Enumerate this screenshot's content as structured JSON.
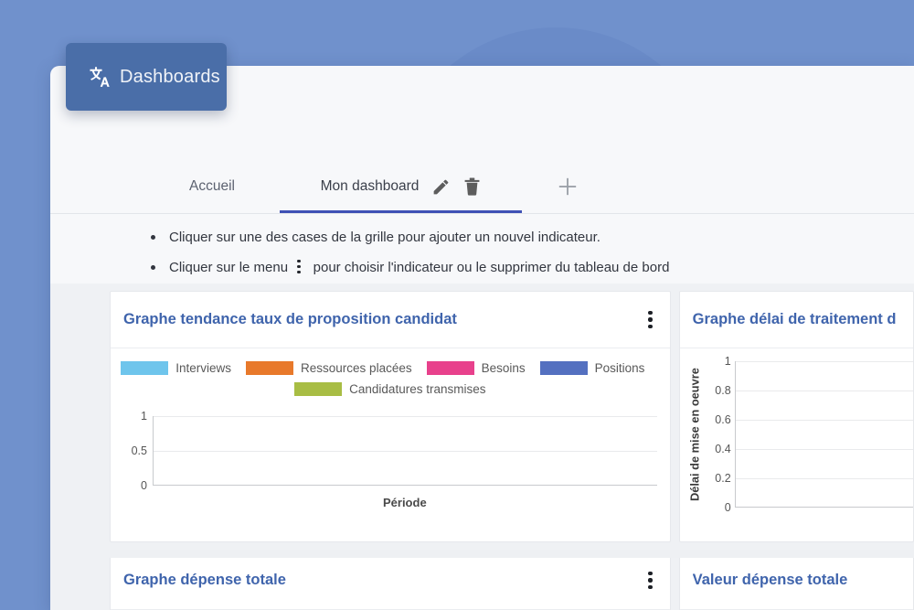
{
  "badge": {
    "label": "Dashboards",
    "icon": "translate-icon",
    "bg_color": "#4a6ea8"
  },
  "tabs": {
    "home_label": "Accueil",
    "active_label": "Mon dashboard",
    "edit_icon": "pencil-icon",
    "delete_icon": "trash-icon",
    "add_icon": "plus-icon",
    "active_underline_color": "#3f51b5"
  },
  "instructions": [
    {
      "before": "Cliquer sur une des cases de la grille pour ajouter un nouvel indicateur.",
      "after": ""
    },
    {
      "before": "Cliquer sur le menu",
      "after": "pour choisir l'indicateur ou le supprimer du tableau de bord"
    }
  ],
  "cards": {
    "trend": {
      "title": "Graphe tendance taux de proposition candidat",
      "menu_icon": "kebab-menu-icon"
    },
    "delay": {
      "title": "Graphe délai de traitement d"
    },
    "expense_chart": {
      "title": "Graphe dépense totale",
      "menu_icon": "kebab-menu-icon"
    },
    "expense_value": {
      "title": "Valeur dépense totale"
    }
  },
  "chart_data": [
    {
      "type": "bar",
      "title": "Graphe tendance taux de proposition candidat",
      "xlabel": "Période",
      "ylabel": "",
      "categories": [],
      "series": [
        {
          "name": "Interviews",
          "color": "#6fc5ec",
          "values": []
        },
        {
          "name": "Ressources placées",
          "color": "#e8792b",
          "values": []
        },
        {
          "name": "Besoins",
          "color": "#e8418c",
          "values": []
        },
        {
          "name": "Positions",
          "color": "#5470c0",
          "values": []
        },
        {
          "name": "Candidatures transmises",
          "color": "#a8bd44",
          "values": []
        }
      ],
      "yticks": [
        "1",
        "0.5",
        "0"
      ],
      "ylim": [
        0,
        1
      ],
      "grid": true,
      "legend_position": "top",
      "empty": true
    },
    {
      "type": "bar",
      "title": "Graphe délai de traitement d",
      "xlabel": "",
      "ylabel": "Délai de mise en oeuvre",
      "categories": [],
      "series": [],
      "yticks": [
        "1",
        "0.8",
        "0.6",
        "0.4",
        "0.2",
        "0"
      ],
      "ylim": [
        0,
        1
      ],
      "grid": true,
      "legend_position": "none",
      "empty": true
    }
  ]
}
